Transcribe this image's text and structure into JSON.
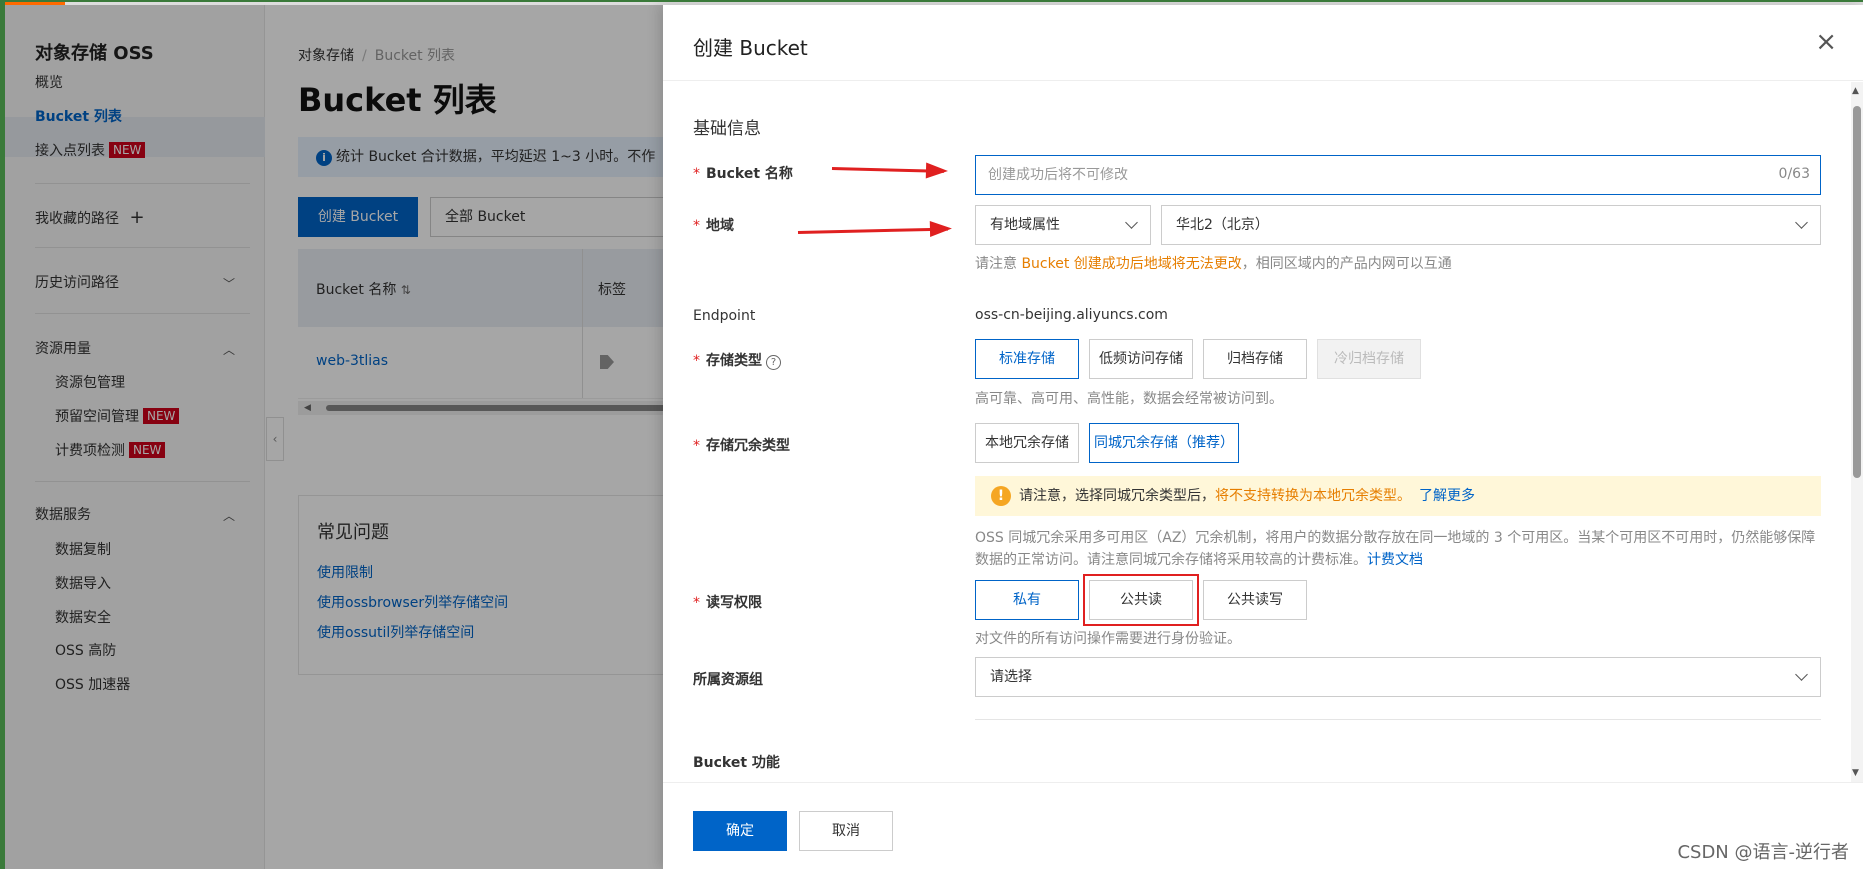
{
  "sidebar": {
    "title": "对象存储 OSS",
    "overview": "概览",
    "bucket_list": "Bucket 列表",
    "access_points": "接入点列表",
    "new_badge": "NEW",
    "favorites": "我收藏的路径",
    "favorites_add": "+",
    "history": "历史访问路径",
    "resource_usage": "资源用量",
    "resource_pack": "资源包管理",
    "reserved_space": "预留空间管理",
    "billing_check": "计费项检测",
    "data_services": "数据服务",
    "data_replication": "数据复制",
    "data_import": "数据导入",
    "data_security": "数据安全",
    "oss_defense": "OSS 高防",
    "oss_accelerator": "OSS 加速器"
  },
  "main": {
    "breadcrumb_root": "对象存储",
    "breadcrumb_sep": "/",
    "breadcrumb_current": "Bucket 列表",
    "title": "Bucket 列表",
    "notice": "统计 Bucket 合计数据，平均延迟 1~3 小时。不作",
    "create_button": "创建 Bucket",
    "filter_value": "全部 Bucket",
    "table": {
      "col_name": "Bucket 名称",
      "col_tags": "标签",
      "rows": [
        {
          "name": "web-3tlias"
        }
      ]
    },
    "faq": {
      "title": "常见问题",
      "links": [
        "使用限制",
        "使用ossbrowser列举存储空间",
        "使用ossutil列举存储空间"
      ]
    }
  },
  "drawer": {
    "title": "创建 Bucket",
    "close": "×",
    "section_basic": "基础信息",
    "bucket_name": {
      "label": "Bucket 名称",
      "placeholder": "创建成功后将不可修改",
      "counter": "0/63"
    },
    "region": {
      "label": "地域",
      "type_value": "有地域属性",
      "region_value": "华北2（北京）",
      "hint_pre": "请注意 ",
      "hint_warn": "Bucket 创建成功后地域将无法更改",
      "hint_post": "，相同区域内的产品内网可以互通"
    },
    "endpoint": {
      "label": "Endpoint",
      "value": "oss-cn-beijing.aliyuncs.com"
    },
    "storage_class": {
      "label": "存储类型",
      "help": "?",
      "options": [
        "标准存储",
        "低频访问存储",
        "归档存储",
        "冷归档存储"
      ],
      "hint": "高可靠、高可用、高性能，数据会经常被访问到。"
    },
    "redundancy": {
      "label": "存储冗余类型",
      "options": [
        "本地冗余存储",
        "同城冗余存储（推荐）"
      ],
      "alert_icon": "!",
      "alert_pre": "请注意，选择同城冗余类型后，",
      "alert_warn": "将不支持转换为本地冗余类型。",
      "alert_link": "了解更多",
      "desc": "OSS 同城冗余采用多可用区（AZ）冗余机制，将用户的数据分散存放在同一地域的 3 个可用区。当某个可用区不可用时，仍然能够保障数据的正常访问。请注意同城冗余存储将采用较高的计费标准。",
      "desc_link": "计费文档"
    },
    "acl": {
      "label": "读写权限",
      "options": [
        "私有",
        "公共读",
        "公共读写"
      ],
      "hint": "对文件的所有访问操作需要进行身份验证。"
    },
    "resource_group": {
      "label": "所属资源组",
      "placeholder": "请选择"
    },
    "next_section_partial": "Bucket 功能",
    "ok": "确定",
    "cancel": "取消"
  },
  "watermark": "CSDN @语言-逆行者",
  "colors": {
    "primary": "#0064c8",
    "warn": "#e67e00",
    "annotation": "#e02020",
    "badge": "#d0021b"
  }
}
